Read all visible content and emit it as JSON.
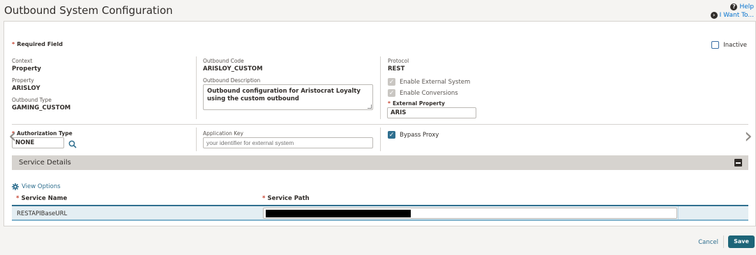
{
  "header": {
    "title": "Outbound System Configuration",
    "help_label": "Help",
    "iwant_label": "I Want To..."
  },
  "form": {
    "required_note": "Required Field",
    "inactive_label": "Inactive",
    "context_label": "Context",
    "context_value": "Property",
    "property_label": "Property",
    "property_value": "ARISLOY",
    "outbound_type_label": "Outbound Type",
    "outbound_type_value": "GAMING_CUSTOM",
    "outbound_code_label": "Outbound Code",
    "outbound_code_value": "ARISLOY_CUSTOM",
    "outbound_desc_label": "Outbound Description",
    "outbound_desc_value": "Outbound configuration for Aristocrat Loyalty using the custom outbound",
    "protocol_label": "Protocol",
    "protocol_value": "REST",
    "enable_external_label": "Enable External System",
    "enable_conversions_label": "Enable Conversions",
    "external_property_label": "External Property",
    "external_property_value": "ARIS",
    "authorization_type_label": "Authorization Type",
    "authorization_type_value": "NONE",
    "application_key_label": "Application Key",
    "application_key_placeholder": "your identifier for external system",
    "bypass_proxy_label": "Bypass Proxy"
  },
  "service_details": {
    "title": "Service Details",
    "view_options_label": "View Options",
    "columns": [
      "Service Name",
      "Service Path"
    ],
    "rows": [
      {
        "service_name": "RESTAPIBaseURL",
        "service_path": ""
      }
    ]
  },
  "footer": {
    "cancel_label": "Cancel",
    "save_label": "Save"
  },
  "colors": {
    "accent": "#2f6f8f",
    "required": "#c74634",
    "save_button": "#1d6578"
  }
}
